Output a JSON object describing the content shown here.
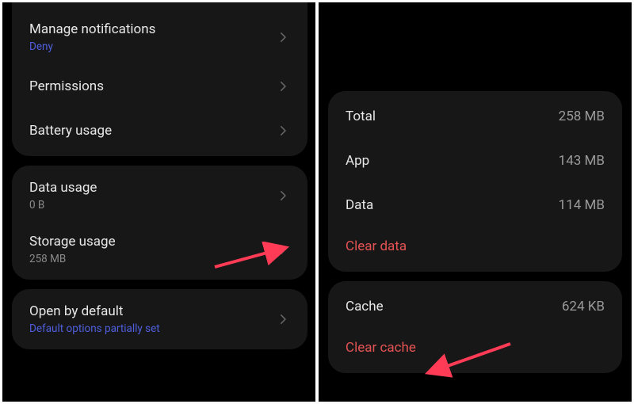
{
  "left": {
    "group1": {
      "notifications": {
        "label": "Manage notifications",
        "sub": "Deny"
      },
      "permissions": {
        "label": "Permissions"
      },
      "battery": {
        "label": "Battery usage"
      }
    },
    "group2": {
      "data_usage": {
        "label": "Data usage",
        "sub": "0 B"
      },
      "storage_usage": {
        "label": "Storage usage",
        "sub": "258 MB"
      }
    },
    "group3": {
      "open_by_default": {
        "label": "Open by default",
        "sub": "Default options partially set"
      }
    }
  },
  "right": {
    "storage_card": {
      "total": {
        "label": "Total",
        "value": "258 MB"
      },
      "app": {
        "label": "App",
        "value": "143 MB"
      },
      "data": {
        "label": "Data",
        "value": "114 MB"
      },
      "clear_data": "Clear data"
    },
    "cache_card": {
      "cache": {
        "label": "Cache",
        "value": "624 KB"
      },
      "clear_cache": "Clear cache"
    }
  },
  "colors": {
    "accent_blue": "#4f5fdd",
    "danger_red": "#e55353"
  }
}
